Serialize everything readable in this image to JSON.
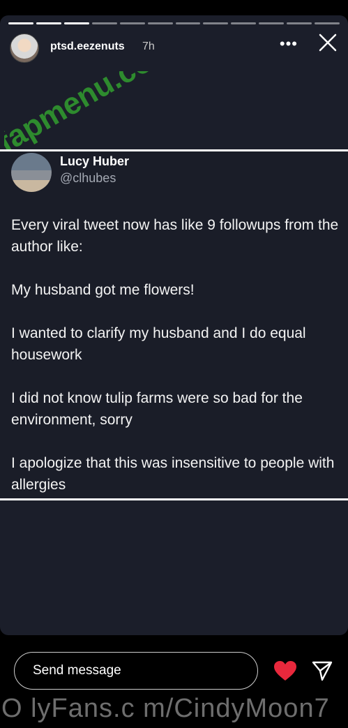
{
  "story": {
    "progress_segments": 12,
    "seen_segments": 3,
    "username": "ptsd.eezenuts",
    "time": "7h",
    "more_label": "•••"
  },
  "watermark": {
    "text": "fapmenu.com",
    "color": "#2e8b2e"
  },
  "tweet": {
    "author_name": "Lucy Huber",
    "author_handle": "@clhubes",
    "paragraphs": [
      "Every viral tweet now has like 9 followups from the author like:",
      "My husband got me flowers!",
      "I wanted to clarify my husband and I do equal housework",
      "I did not know tulip farms were so bad for the environment, sorry",
      "I apologize that this was insensitive to people with allergies"
    ]
  },
  "footer": {
    "message_placeholder": "Send message",
    "heart_color": "#e8283c"
  },
  "overlay_text": "O lyFans.c m/CindyMoon7"
}
